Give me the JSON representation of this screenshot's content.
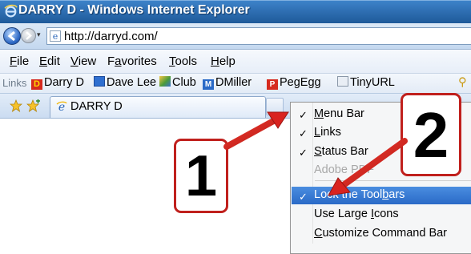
{
  "window": {
    "title": "DARRY D - Windows Internet Explorer"
  },
  "address_bar": {
    "url": "http://darryd.com/",
    "dropdown_glyph": "▾"
  },
  "menu_bar": {
    "items": [
      "File",
      "Edit",
      "View",
      "Favorites",
      "Tools",
      "Help"
    ],
    "accel": [
      "F",
      "E",
      "V",
      "a",
      "T",
      "H"
    ]
  },
  "links_bar": {
    "label": "Links",
    "items": [
      {
        "label": "Darry D",
        "icon": "darryd-icon"
      },
      {
        "label": "Dave Lee",
        "icon": "davelee-icon"
      },
      {
        "label": "Club",
        "icon": "club-icon"
      },
      {
        "label": "DMiller",
        "icon": "dmiller-icon"
      },
      {
        "label": "PegEgg",
        "icon": "pegegg-icon"
      },
      {
        "label": "TinyURL",
        "icon": "tinyurl-icon"
      }
    ]
  },
  "tab_bar": {
    "active_tab": "DARRY D"
  },
  "context_menu": {
    "items": [
      {
        "label": "Menu Bar",
        "checked": true,
        "enabled": true,
        "highlighted": false
      },
      {
        "label": "Links",
        "checked": true,
        "enabled": true,
        "highlighted": false
      },
      {
        "label": "Status Bar",
        "checked": true,
        "enabled": true,
        "highlighted": false
      },
      {
        "label": "Adobe PDF",
        "checked": false,
        "enabled": false,
        "highlighted": false
      },
      {
        "label": "Lock the Toolbars",
        "checked": true,
        "enabled": true,
        "highlighted": true
      },
      {
        "label": "Use Large Icons",
        "checked": false,
        "enabled": true,
        "highlighted": false
      },
      {
        "label": "Customize Command Bar",
        "checked": false,
        "enabled": true,
        "highlighted": false
      }
    ],
    "check_glyph": "✓"
  },
  "annotations": {
    "callout_1": "1",
    "callout_2": "2",
    "arrow_color": "#d9231f"
  },
  "colors": {
    "title_bar": "#2f6fb3",
    "highlight": "#2a6ac7",
    "callout_border": "#c0201d"
  }
}
